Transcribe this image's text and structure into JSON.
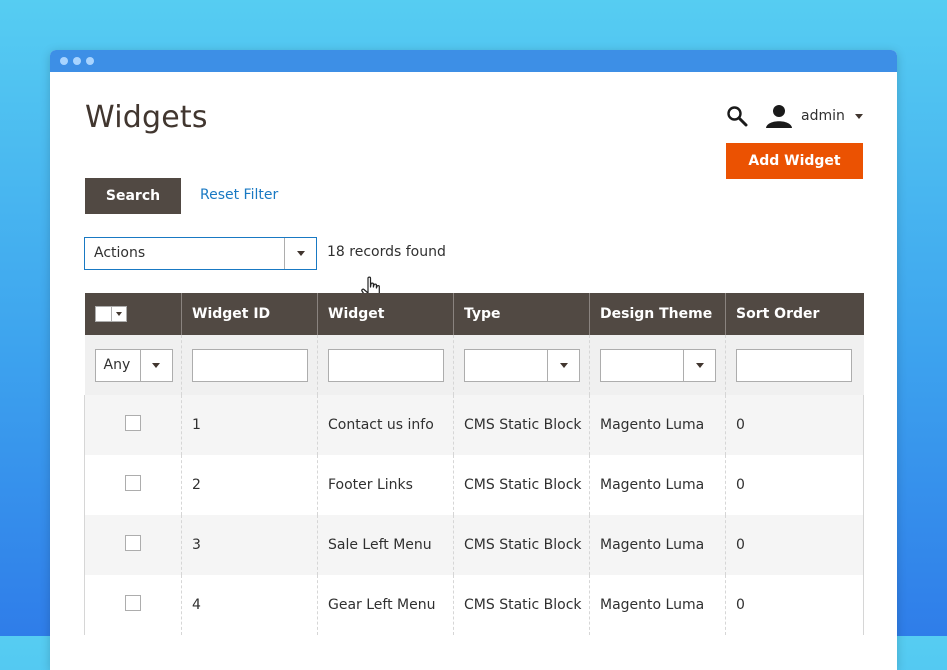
{
  "page": {
    "title": "Widgets",
    "user": {
      "name": "admin",
      "icon": "user-icon"
    },
    "search_icon": "search-icon"
  },
  "buttons": {
    "add_widget": "Add Widget",
    "search": "Search",
    "reset_filter": "Reset Filter"
  },
  "actions": {
    "label": "Actions",
    "records_found": "18 records found"
  },
  "grid": {
    "columns": [
      "Widget ID",
      "Widget",
      "Type",
      "Design Theme",
      "Sort Order"
    ],
    "filters": {
      "any": "Any"
    },
    "rows": [
      {
        "id": "1",
        "widget": "Contact us info",
        "type": "CMS Static Block",
        "theme": "Magento Luma",
        "sort": "0"
      },
      {
        "id": "2",
        "widget": "Footer Links",
        "type": "CMS Static Block",
        "theme": "Magento Luma",
        "sort": "0"
      },
      {
        "id": "3",
        "widget": "Sale Left Menu",
        "type": "CMS Static Block",
        "theme": "Magento Luma",
        "sort": "0"
      },
      {
        "id": "4",
        "widget": "Gear Left Menu",
        "type": "CMS Static Block",
        "theme": "Magento Luma",
        "sort": "0"
      }
    ]
  },
  "colors": {
    "accent": "#eb5202",
    "header_bg": "#514943",
    "link": "#1979c3",
    "window_bar": "#3d8fe6"
  }
}
